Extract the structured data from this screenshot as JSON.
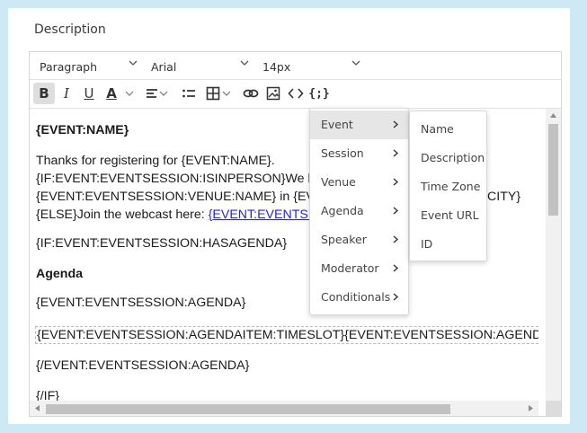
{
  "section_label": "Description",
  "toolbar": {
    "block_format": "Paragraph",
    "font_family": "Arial",
    "font_size": "14px",
    "bold_label": "B",
    "italic_label": "I",
    "underline_label": "U",
    "font_color_label": "A",
    "merge_tag_label": "{;}"
  },
  "content": {
    "lines": [
      "{EVENT:NAME}",
      "Thanks for registering for {EVENT:NAME}.",
      "{IF:EVENT:EVENTSESSION:ISINPERSON}We lo",
      "{EVENT:EVENTSESSION:VENUE:NAME} in {EV",
      "CITY}",
      "{ELSE}Join the webcast here: ",
      "{EVENT:EVENTSE",
      "{IF:EVENT:EVENTSESSION:HASAGENDA}",
      "Agenda",
      "{EVENT:EVENTSESSION:AGENDA}",
      "{EVENT:EVENTSESSION:AGENDAITEM:TIMESLOT}{EVENT:EVENTSESSION:AGENDA",
      "{/EVENT:EVENTSESSION:AGENDA}",
      "{/IF}"
    ]
  },
  "menu": {
    "items": [
      "Event",
      "Session",
      "Venue",
      "Agenda",
      "Speaker",
      "Moderator",
      "Conditionals"
    ],
    "active_index": 0
  },
  "submenu": {
    "items": [
      "Name",
      "Description",
      "Time Zone",
      "Event URL",
      "ID"
    ]
  },
  "colors": {
    "background": "#cde9f6",
    "link": "#2426d6",
    "active_menu": "#e6e6e6"
  }
}
